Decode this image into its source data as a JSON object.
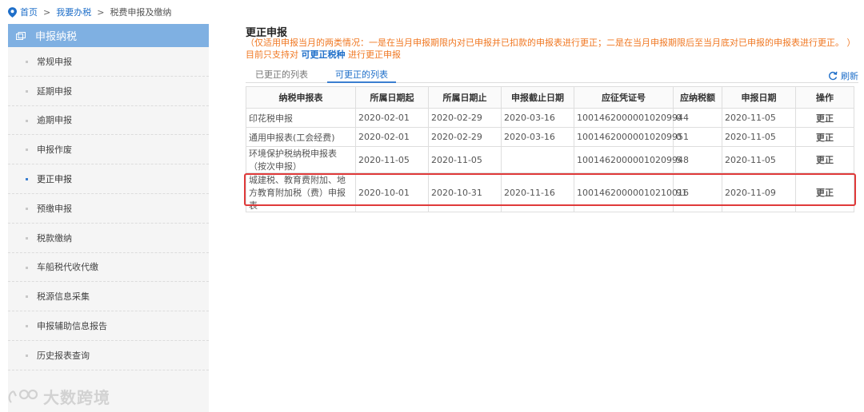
{
  "breadcrumb": {
    "home": "首页",
    "sep1": ">",
    "tax": "我要办税",
    "sep2": ">",
    "current": "税费申报及缴纳"
  },
  "sidebar": {
    "header": "申报纳税",
    "items": [
      {
        "label": "常规申报"
      },
      {
        "label": "延期申报"
      },
      {
        "label": "逾期申报"
      },
      {
        "label": "申报作废"
      },
      {
        "label": "更正申报",
        "active": true
      },
      {
        "label": "预缴申报"
      },
      {
        "label": "税款缴纳"
      },
      {
        "label": "车船税代收代缴"
      },
      {
        "label": "税源信息采集"
      },
      {
        "label": "申报辅助信息报告"
      },
      {
        "label": "历史报表查询"
      }
    ]
  },
  "watermark": "大数跨境",
  "main": {
    "title": "更正申报",
    "notice_line1": "（仅适用申报当月的两类情况：一是在当月申报期限内对已申报并已扣款的申报表进行更正；二是在当月申报期限后至当月底对已申报的申报表进行更正。 ）",
    "notice_line2_pre": "目前只支持对",
    "notice_line2_link": "可更正税种",
    "notice_line2_post": "进行更正申报",
    "tabs": [
      {
        "label": "已更正的列表"
      },
      {
        "label": "可更正的列表"
      }
    ],
    "refresh": "刷新"
  },
  "table": {
    "headers": [
      "纳税申报表",
      "所属日期起",
      "所属日期止",
      "申报截止日期",
      "应征凭证号",
      "应纳税额",
      "申报日期",
      "操作"
    ],
    "rows": [
      [
        "印花税申报",
        "2020-02-01",
        "2020-02-29",
        "2020-03-16",
        "10014620000010209944",
        "0",
        "2020-11-05",
        "更正"
      ],
      [
        "通用申报表(工会经费)",
        "2020-02-01",
        "2020-02-29",
        "2020-03-16",
        "10014620000010209951",
        "0",
        "2020-11-05",
        "更正"
      ],
      [
        "环境保护税纳税申报表（按次申报）",
        "2020-11-05",
        "2020-11-05",
        "",
        "10014620000010209948",
        "5",
        "2020-11-05",
        "更正"
      ],
      [
        "城建税、教育费附加、地方教育附加税（费）申报表",
        "2020-10-01",
        "2020-10-31",
        "2020-11-16",
        "10014620000010210016",
        "91",
        "2020-11-09",
        "更正"
      ]
    ]
  },
  "colors": {
    "accent": "#1f6fc9",
    "sidebar_header": "#7fb0e2",
    "notice": "#f07823",
    "highlight": "#e03a3a"
  }
}
